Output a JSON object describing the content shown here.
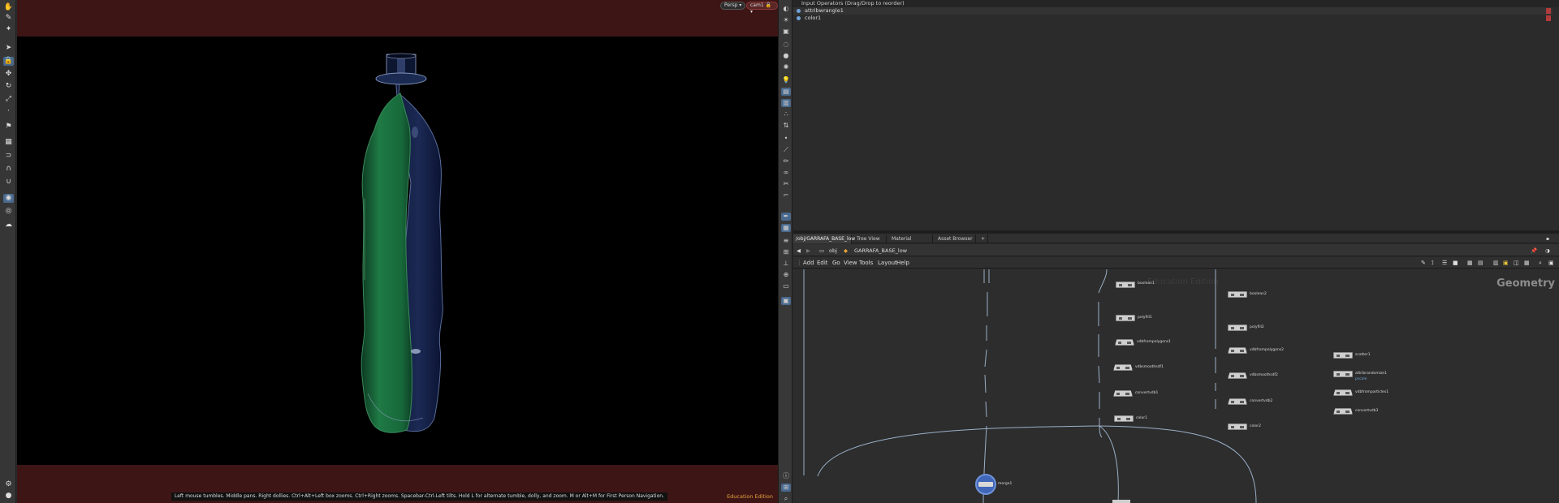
{
  "viewport": {
    "camera_mode": "Persp ▾",
    "camera_name": "cam1 🔒▾",
    "status_message": "Left mouse tumbles. Middle pans. Right dollies. Ctrl+Alt+Left box zooms. Ctrl+Right zooms. Spacebar-Ctrl-Left tilts. Hold L for alternate tumble, dolly, and zoom.    M or Alt+M for First Person Navigation.",
    "edition_label": "Education Edition",
    "bottle_colors": {
      "left": "#1f7a45",
      "right": "#1b2a55",
      "background": "#000000",
      "frame": "#3d1515"
    }
  },
  "input_operators": {
    "header": "Input Operators (Drag/Drop to reorder)",
    "items": [
      "attribwrangle1",
      "color1"
    ]
  },
  "network": {
    "tabs": [
      "/obj/GARRAFA_BASE_low",
      "Tree View",
      "Material Palette",
      "Asset Browser"
    ],
    "path": {
      "root": "obj",
      "node": "GARRAFA_BASE_low"
    },
    "menu": [
      "Add",
      "Edit",
      "Go",
      "View",
      "Tools",
      "Layout",
      "Help"
    ],
    "context_label": "Geometry",
    "watermark": "Education Edition",
    "nodes": [
      {
        "name": "boolean1",
        "shape": "rect"
      },
      {
        "name": "polyfill1",
        "shape": "rect"
      },
      {
        "name": "vdbfrompolygons1",
        "shape": "trap"
      },
      {
        "name": "vdbsmoothsdf1",
        "shape": "trap"
      },
      {
        "name": "convertvdb1",
        "shape": "trap"
      },
      {
        "name": "color1",
        "shape": "rect"
      },
      {
        "name": "boolean2",
        "shape": "rect"
      },
      {
        "name": "polyfill2",
        "shape": "rect"
      },
      {
        "name": "vdbfrompolygons2",
        "shape": "trap"
      },
      {
        "name": "vdbsmoothsdf2",
        "shape": "trap"
      },
      {
        "name": "convertvdb2",
        "shape": "trap"
      },
      {
        "name": "color2",
        "shape": "rect"
      },
      {
        "name": "scatter1",
        "shape": "rect"
      },
      {
        "name": "attribrandomize1",
        "shape": "rect"
      },
      {
        "name": "vdbfromparticles1",
        "shape": "trap"
      },
      {
        "name": "convertvdb3",
        "shape": "trap"
      },
      {
        "name": "merge1",
        "shape": "circle"
      }
    ],
    "attribrandomize_sub": "pscale",
    "accent_color": "#49698e",
    "wire_color": "#9ab0c8"
  }
}
